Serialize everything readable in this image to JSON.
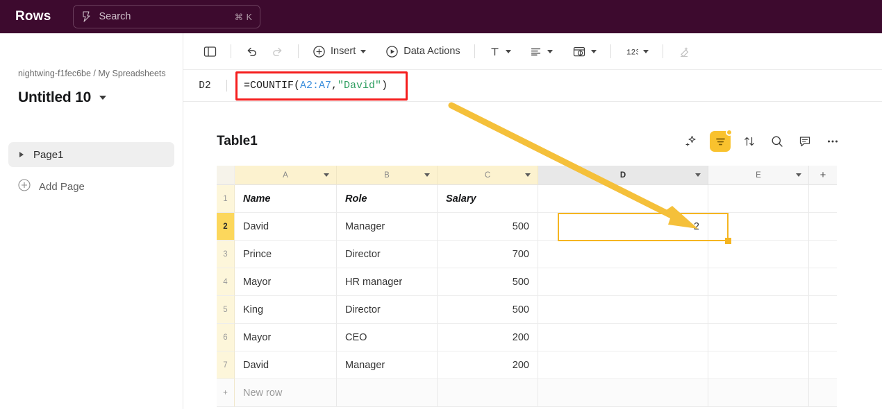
{
  "topbar": {
    "brand": "Rows",
    "search_placeholder": "Search",
    "search_shortcut": "⌘ K",
    "bg_color": "#3d0a2e"
  },
  "sidebar": {
    "breadcrumb": "nightwing-f1fec6be / My Spreadsheets",
    "doc_title": "Untitled 10",
    "pages": [
      {
        "label": "Page1"
      }
    ],
    "add_page_label": "Add Page"
  },
  "toolbar": {
    "items": [
      {
        "name": "toggle-panel",
        "label": ""
      },
      {
        "name": "undo",
        "label": ""
      },
      {
        "name": "redo",
        "label": ""
      },
      {
        "name": "insert",
        "label": "Insert"
      },
      {
        "name": "data-actions",
        "label": "Data Actions"
      },
      {
        "name": "text-format",
        "label": ""
      },
      {
        "name": "align",
        "label": ""
      },
      {
        "name": "cell-format",
        "label": ""
      },
      {
        "name": "number-format",
        "label": ""
      },
      {
        "name": "clear-format",
        "label": ""
      }
    ],
    "insert_label": "Insert",
    "data_actions_label": "Data Actions"
  },
  "formula_bar": {
    "cell_ref": "D2",
    "formula_prefix": "=COUNTIF(",
    "formula_range": "A2:A7",
    "formula_comma": ",",
    "formula_string": "\"David\"",
    "formula_suffix": ")",
    "highlight_color": "#f51d1d"
  },
  "table": {
    "name": "Table1",
    "actions": [
      "ai-sparkle-icon",
      "filter-icon",
      "sort-icon",
      "search-icon",
      "comment-icon",
      "more-icon"
    ],
    "filter_active_color": "#f9c22e",
    "columns": [
      "",
      "A",
      "B",
      "C",
      "D",
      "E",
      "+"
    ],
    "headers": [
      "Name",
      "Role",
      "Salary",
      "",
      ""
    ],
    "rows": [
      {
        "n": "1",
        "a": "Name",
        "b": "Role",
        "c": "Salary",
        "d": "",
        "e": ""
      },
      {
        "n": "2",
        "a": "David",
        "b": "Manager",
        "c": "500",
        "d": "2",
        "e": ""
      },
      {
        "n": "3",
        "a": "Prince",
        "b": "Director",
        "c": "700",
        "d": "",
        "e": ""
      },
      {
        "n": "4",
        "a": "Mayor",
        "b": "HR manager",
        "c": "500",
        "d": "",
        "e": ""
      },
      {
        "n": "5",
        "a": "King",
        "b": "Director",
        "c": "500",
        "d": "",
        "e": ""
      },
      {
        "n": "6",
        "a": "Mayor",
        "b": "CEO",
        "c": "200",
        "d": "",
        "e": ""
      },
      {
        "n": "7",
        "a": "David",
        "b": "Manager",
        "c": "200",
        "d": "",
        "e": ""
      }
    ],
    "new_row_label": "New row",
    "new_row_plus": "+",
    "selected_cell": "D2",
    "selected_cell_value": "2",
    "selection_color": "#f5b521"
  },
  "annotation": {
    "arrow_color": "#f5c03a",
    "points_from": "formula-bar",
    "points_to": "cell-D2"
  }
}
